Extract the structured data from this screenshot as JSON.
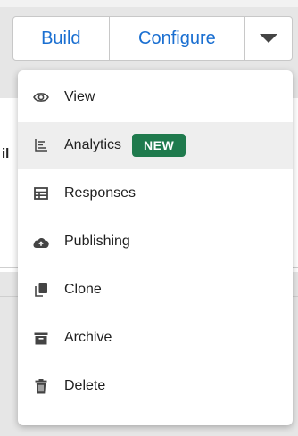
{
  "toolbar": {
    "build_label": "Build",
    "configure_label": "Configure",
    "dropdown_icon": "caret-down-icon"
  },
  "background": {
    "partial_text": "il"
  },
  "menu": {
    "items": [
      {
        "label": "View",
        "icon": "eye-icon"
      },
      {
        "label": "Analytics",
        "icon": "analytics-icon",
        "badge": "NEW"
      },
      {
        "label": "Responses",
        "icon": "table-icon"
      },
      {
        "label": "Publishing",
        "icon": "cloud-upload-icon"
      },
      {
        "label": "Clone",
        "icon": "copy-icon"
      },
      {
        "label": "Archive",
        "icon": "archive-icon"
      },
      {
        "label": "Delete",
        "icon": "trash-icon"
      }
    ]
  },
  "colors": {
    "link_blue": "#1a6fd1",
    "badge_green": "#1f7a4d",
    "highlight": "#eeeeee"
  }
}
